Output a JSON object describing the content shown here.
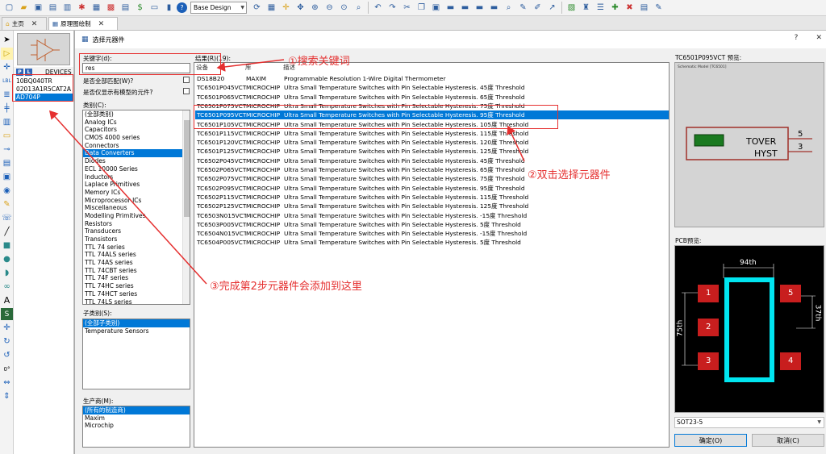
{
  "toolbar": {
    "design_select": "Base Design"
  },
  "tabs": [
    {
      "label": "主页"
    },
    {
      "label": "原理图绘制"
    }
  ],
  "device_panel": {
    "p_button": "P",
    "l_button": "L",
    "header_label": "DEVICES",
    "items": [
      {
        "label": "10BQ040TR"
      },
      {
        "label": "02013A1R5CAT2A"
      },
      {
        "label": "AD704P"
      }
    ]
  },
  "dialog": {
    "title": "选择元器件",
    "help": "?",
    "close": "✕",
    "keyword_label": "关键字(d):",
    "keyword_value": "res",
    "match_all_label": "是否全部匹配(W)?",
    "models_only_label": "是否仅显示有模型的元件?",
    "category_label": "类别(C):",
    "categories": [
      "(全部类别)",
      "Analog ICs",
      "Capacitors",
      "CMOS 4000 series",
      "Connectors",
      "Data Converters",
      "Diodes",
      "ECL 10000 Series",
      "Inductors",
      "Laplace Primitives",
      "Memory ICs",
      "Microprocessor ICs",
      "Miscellaneous",
      "Modelling Primitives",
      "Resistors",
      "Transducers",
      "Transistors",
      "TTL 74 series",
      "TTL 74ALS series",
      "TTL 74AS series",
      "TTL 74CBT series",
      "TTL 74F series",
      "TTL 74HC series",
      "TTL 74HCT series",
      "TTL 74LS series"
    ],
    "selected_category_index": 5,
    "subcategory_label": "子类别(S):",
    "subcategories": [
      "(全部子类别)",
      "Temperature Sensors"
    ],
    "manufacturer_label": "生产商(M):",
    "manufacturers": [
      "(所有的制造商)",
      "Maxim",
      "Microchip"
    ],
    "results_label": "结果(R)(19):",
    "results_headers": {
      "device": "设备",
      "library": "库",
      "description": "描述"
    },
    "results": [
      {
        "device": "DS18B20",
        "library": "MAXIM",
        "description": "Programmable Resolution 1-Wire Digital Thermometer"
      },
      {
        "device": "TC6501P045VCT",
        "library": "MICROCHIP",
        "description": "Ultra Small Temperature Switches with Pin Selectable Hysteresis. 45度 Threshold"
      },
      {
        "device": "TC6501P065VCT",
        "library": "MICROCHIP",
        "description": "Ultra Small Temperature Switches with Pin Selectable Hysteresis. 65度 Threshold"
      },
      {
        "device": "TC6501P075VCT",
        "library": "MICROCHIP",
        "description": "Ultra Small Temperature Switches with Pin Selectable Hysteresis. 75度 Threshold"
      },
      {
        "device": "TC6501P095VCT",
        "library": "MICROCHIP",
        "description": "Ultra Small Temperature Switches with Pin Selectable Hysteresis. 95度 Threshold"
      },
      {
        "device": "TC6501P105VCT",
        "library": "MICROCHIP",
        "description": "Ultra Small Temperature Switches with Pin Selectable Hysteresis. 105度 Threshold"
      },
      {
        "device": "TC6501P115VCT",
        "library": "MICROCHIP",
        "description": "Ultra Small Temperature Switches with Pin Selectable Hysteresis. 115度 Threshold"
      },
      {
        "device": "TC6501P120VCT",
        "library": "MICROCHIP",
        "description": "Ultra Small Temperature Switches with Pin Selectable Hysteresis. 120度 Threshold"
      },
      {
        "device": "TC6501P125VCT",
        "library": "MICROCHIP",
        "description": "Ultra Small Temperature Switches with Pin Selectable Hysteresis. 125度 Threshold"
      },
      {
        "device": "TC6502P045VCT",
        "library": "MICROCHIP",
        "description": "Ultra Small Temperature Switches with Pin Selectable Hysteresis. 45度 Threshold"
      },
      {
        "device": "TC6502P065VCT",
        "library": "MICROCHIP",
        "description": "Ultra Small Temperature Switches with Pin Selectable Hysteresis. 65度 Threshold"
      },
      {
        "device": "TC6502P075VCT",
        "library": "MICROCHIP",
        "description": "Ultra Small Temperature Switches with Pin Selectable Hysteresis. 75度 Threshold"
      },
      {
        "device": "TC6502P095VCT",
        "library": "MICROCHIP",
        "description": "Ultra Small Temperature Switches with Pin Selectable Hysteresis. 95度 Threshold"
      },
      {
        "device": "TC6502P115VCT",
        "library": "MICROCHIP",
        "description": "Ultra Small Temperature Switches with Pin Selectable Hysteresis. 115度 Threshold"
      },
      {
        "device": "TC6502P125VCT",
        "library": "MICROCHIP",
        "description": "Ultra Small Temperature Switches with Pin Selectable Hysteresis. 125度 Threshold"
      },
      {
        "device": "TC6503N015VCT",
        "library": "MICROCHIP",
        "description": "Ultra Small Temperature Switches with Pin Selectable Hysteresis. -15度 Threshold"
      },
      {
        "device": "TC6503P005VCT",
        "library": "MICROCHIP",
        "description": "Ultra Small Temperature Switches with Pin Selectable Hysteresis. 5度 Threshold"
      },
      {
        "device": "TC6504N015VCT",
        "library": "MICROCHIP",
        "description": "Ultra Small Temperature Switches with Pin Selectable Hysteresis. -15度 Threshold"
      },
      {
        "device": "TC6504P005VCT",
        "library": "MICROCHIP",
        "description": "Ultra Small Temperature Switches with Pin Selectable Hysteresis. 5度 Threshold"
      }
    ],
    "selected_result_index": 4,
    "schematic_preview_label": "TC6501P095VCT 预览:",
    "schematic_caption": "Schematic Model [TC6501]",
    "schematic_pins": {
      "tover": "TOVER",
      "hyst": "HYST",
      "pin5": "5",
      "pin3": "3"
    },
    "pcb_preview_label": "PCB预览:",
    "pcb": {
      "width_dim": "94th",
      "height_dim": "75th",
      "right_dim": "37th",
      "pads": [
        "1",
        "2",
        "3",
        "4",
        "5"
      ]
    },
    "package": "SOT23-5",
    "ok_button": "确定(O)",
    "cancel_button": "取消(C)"
  },
  "annotations": {
    "step1": "①搜索关键词",
    "step2": "②双击选择元器件",
    "step3": "③完成第2步元器件会添加到这里"
  },
  "colors": {
    "selection": "#0078d7",
    "annotation": "#e53030",
    "pcb_outline": "#00e5f0",
    "pcb_pad": "#c81e1e"
  }
}
